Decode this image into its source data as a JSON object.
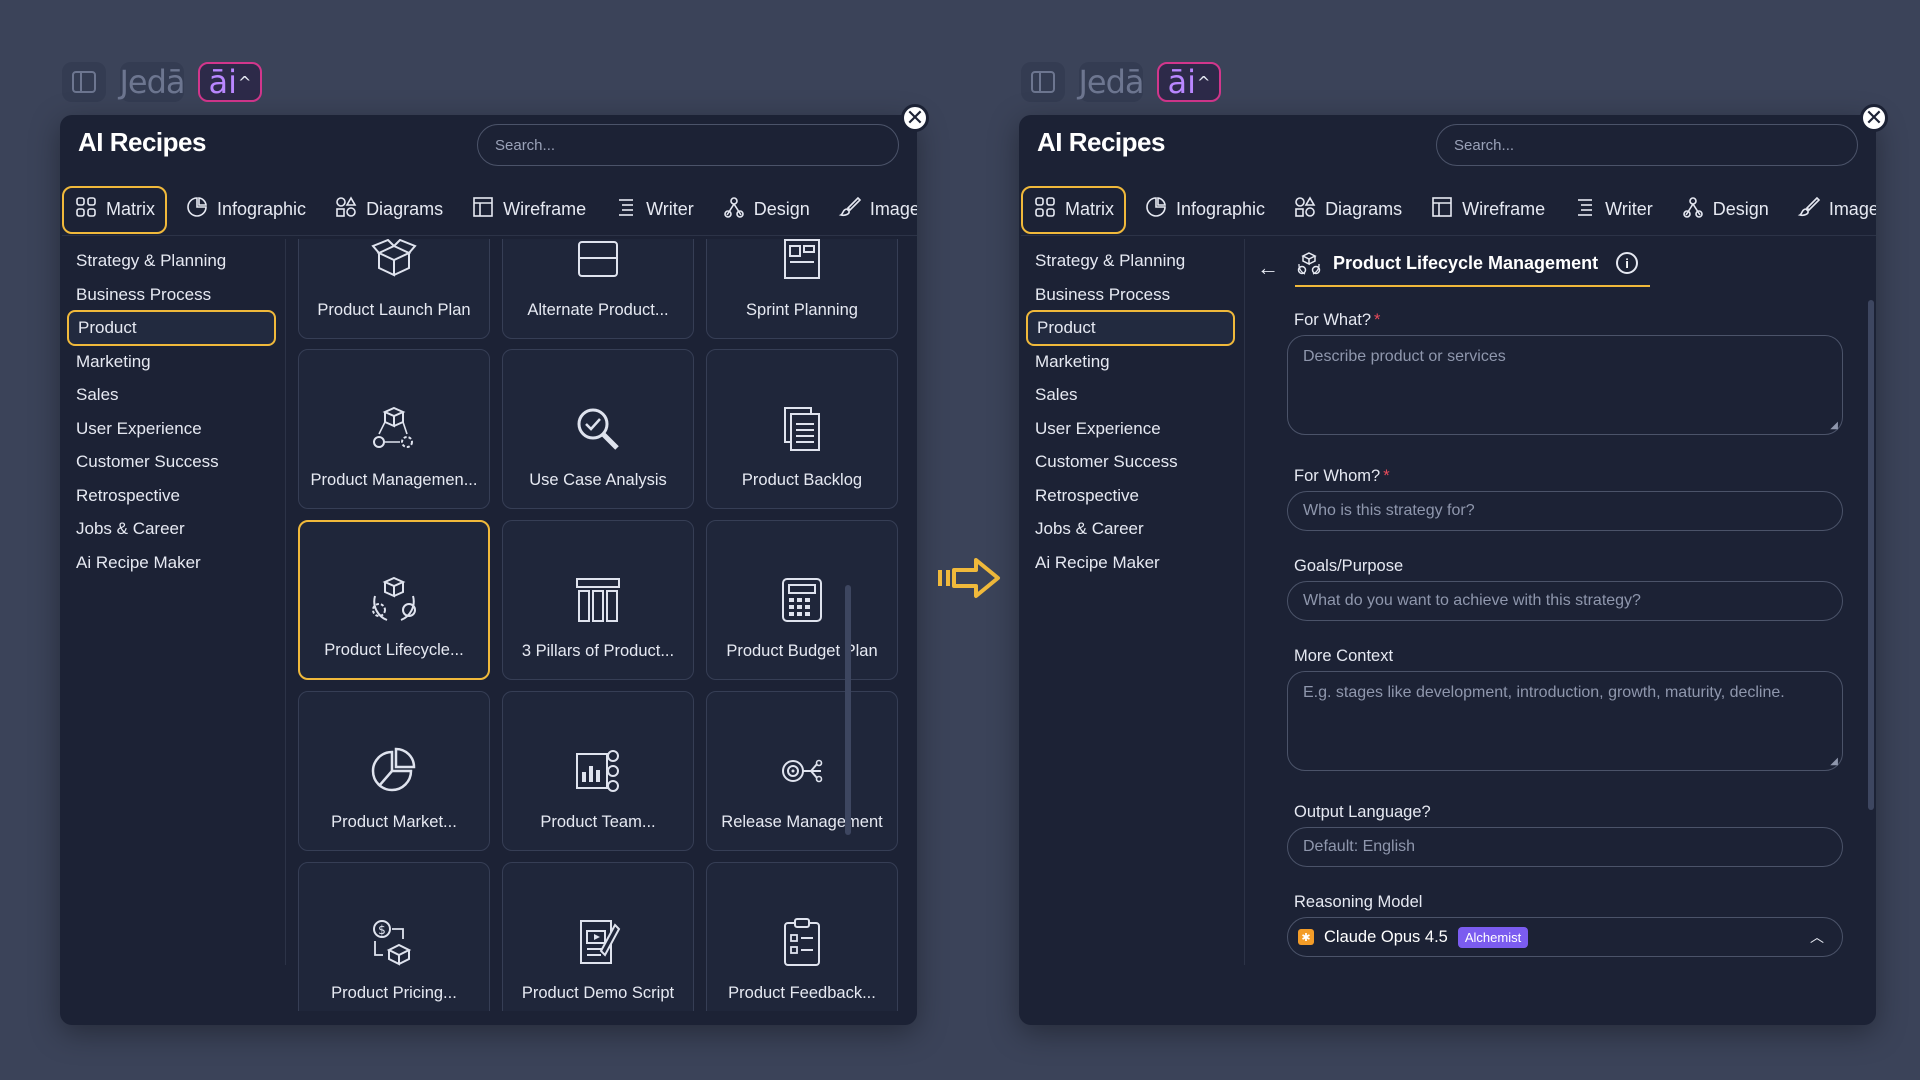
{
  "topbar": {
    "logo_text": "Jedā",
    "ai_text": "āi",
    "ai_caret": "^"
  },
  "panel_title": "AI Recipes",
  "search": {
    "placeholder": "Search..."
  },
  "tabs": [
    {
      "label": "Matrix",
      "icon": "grid-icon",
      "active": true
    },
    {
      "label": "Infographic",
      "icon": "pie-icon",
      "active": false
    },
    {
      "label": "Diagrams",
      "icon": "shapes-icon",
      "active": false
    },
    {
      "label": "Wireframe",
      "icon": "wireframe-icon",
      "active": false
    },
    {
      "label": "Writer",
      "icon": "text-icon",
      "active": false
    },
    {
      "label": "Design",
      "icon": "design-icon",
      "active": false
    },
    {
      "label": "Image",
      "icon": "brush-icon",
      "active": false
    }
  ],
  "categories": [
    "Strategy & Planning",
    "Business Process",
    "Product",
    "Marketing",
    "Sales",
    "User Experience",
    "Customer Success",
    "Retrospective",
    "Jobs & Career",
    "Ai Recipe Maker"
  ],
  "active_category": "Product",
  "recipes": [
    {
      "label": "Product Launch Plan",
      "icon": "box-icon"
    },
    {
      "label": "Alternate Product...",
      "icon": "layout-icon"
    },
    {
      "label": "Sprint Planning",
      "icon": "board-icon"
    },
    {
      "label": "Product Managemen...",
      "icon": "cube-gear-icon"
    },
    {
      "label": "Use Case Analysis",
      "icon": "magnifier-icon"
    },
    {
      "label": "Product Backlog",
      "icon": "documents-icon"
    },
    {
      "label": "Product Lifecycle...",
      "icon": "cycle-icon",
      "selected": true
    },
    {
      "label": "3 Pillars of Product...",
      "icon": "pillars-icon"
    },
    {
      "label": "Product Budget Plan",
      "icon": "calculator-icon"
    },
    {
      "label": "Product Market...",
      "icon": "pie-chart-icon"
    },
    {
      "label": "Product Team...",
      "icon": "team-chart-icon"
    },
    {
      "label": "Release Management",
      "icon": "target-network-icon"
    },
    {
      "label": "Product Pricing...",
      "icon": "pricing-icon"
    },
    {
      "label": "Product Demo Script",
      "icon": "script-icon"
    },
    {
      "label": "Product Feedback...",
      "icon": "clipboard-icon"
    }
  ],
  "form": {
    "title": "Product Lifecycle Management",
    "back_label": "←",
    "info_label": "i",
    "fields": [
      {
        "label": "For What?",
        "required": true,
        "placeholder": "Describe product or services",
        "type": "multi"
      },
      {
        "label": "For Whom?",
        "required": true,
        "placeholder": "Who is this strategy for?",
        "type": "single"
      },
      {
        "label": "Goals/Purpose",
        "required": false,
        "placeholder": "What do you want to achieve with this strategy?",
        "type": "single"
      },
      {
        "label": "More Context",
        "required": false,
        "placeholder": "E.g. stages like development, introduction, growth, maturity, decline.",
        "type": "multi"
      },
      {
        "label": "Output Language?",
        "required": false,
        "placeholder": "Default: English",
        "type": "single"
      }
    ],
    "reasoning": {
      "label": "Reasoning Model",
      "model": "Claude Opus 4.5",
      "badge": "Alchemist"
    },
    "required_mark": "*"
  },
  "close_label": "✕",
  "colors": {
    "accent": "#f0b93b",
    "panel": "#1c2235",
    "background": "#3b4359",
    "badge": "#7b5cf0",
    "brand_ai": "#d2368c"
  }
}
